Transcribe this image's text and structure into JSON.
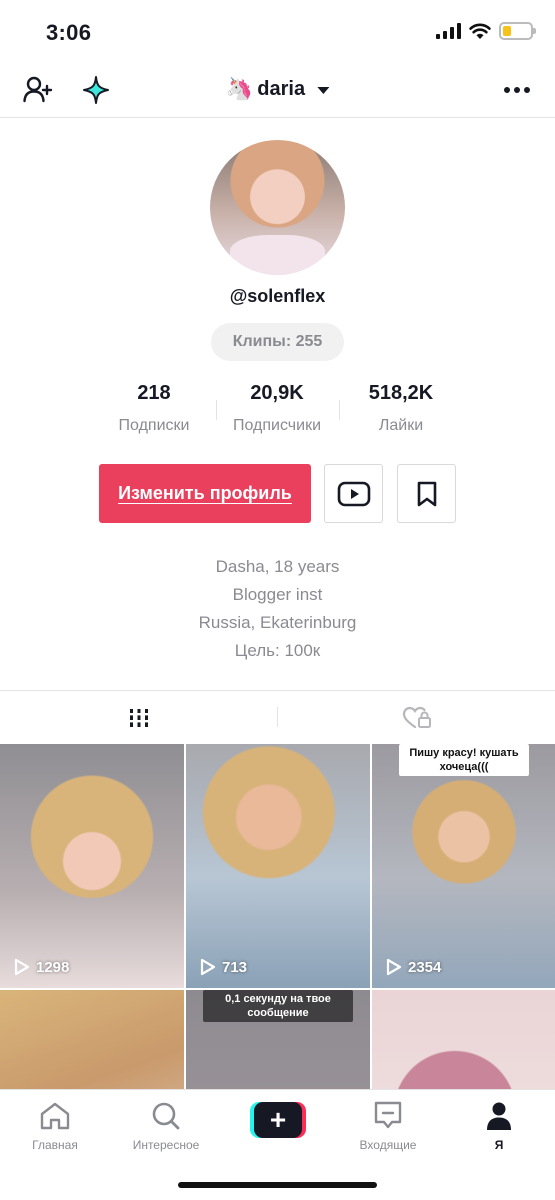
{
  "status": {
    "time": "3:06",
    "battery_color": "#f7c31a",
    "battery_level": 0.3
  },
  "header": {
    "emoji": "🦄",
    "username": "daria",
    "icons": [
      "add-user-icon",
      "sparkle-icon",
      "chevron-down-icon",
      "more-icon"
    ]
  },
  "profile": {
    "handle": "@solenflex",
    "clips": "Клипы: 255",
    "stats": [
      {
        "value": "218",
        "label": "Подписки"
      },
      {
        "value": "20,9K",
        "label": "Подписчики"
      },
      {
        "value": "518,2K",
        "label": "Лайки"
      }
    ],
    "edit_button": "Изменить профиль",
    "bio": [
      "Dasha, 18 years",
      "Blogger inst",
      "Russia, Ekaterinburg",
      "Цель: 100к"
    ]
  },
  "tabs": [
    "videos-grid-icon",
    "liked-locked-icon"
  ],
  "videos": [
    {
      "views": "1298",
      "caption": ""
    },
    {
      "views": "713",
      "caption": ""
    },
    {
      "views": "2354",
      "caption": "Пишу красу! кушать хочеца((("
    },
    {
      "views": "",
      "caption": ""
    },
    {
      "views": "",
      "caption": "0,1 секунду на твое сообщение"
    },
    {
      "views": "",
      "caption": ""
    }
  ],
  "nav": {
    "home": "Главная",
    "discover": "Интересное",
    "create": "+",
    "inbox": "Входящие",
    "me": "Я"
  },
  "colors": {
    "accent": "#ea3f5d",
    "text": "#161823",
    "muted": "#8a8b91",
    "cyan": "#25f4ee",
    "red": "#fe2c55"
  }
}
